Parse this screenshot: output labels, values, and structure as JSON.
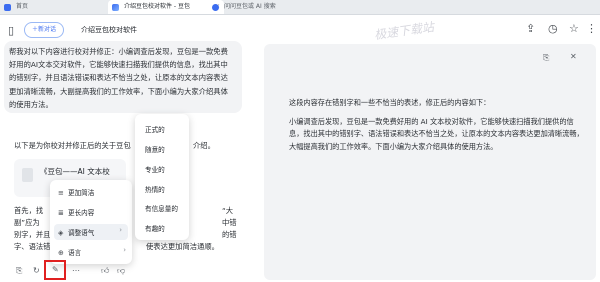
{
  "browser": {
    "tabs": [
      {
        "label": "首页",
        "icon": "home-icon",
        "color": "#3b6cf0"
      },
      {
        "label": "介绍豆包校对软件 - 豆包",
        "icon": "doubao-icon",
        "color": "#3b6cf0"
      },
      {
        "label": "问问豆包或 AI 搜索",
        "icon": "search-icon",
        "color": "#3b6cf0"
      }
    ]
  },
  "header": {
    "new_chat": "新对话",
    "title": "介绍豆包校对软件"
  },
  "watermark": "极速下载站",
  "chat": {
    "user_message": "帮我对以下内容进行校对并修正：小编调查后发现，豆包是一款免费好用的AI文本交对软件，它能够快速扫描我们提供的信息，找出其中的错别字，并且语法错误和表达不恰当之处，让原本的文本内容表达更加清晰流畅，大副提高我们的工作效率，下面小编为大家介绍具体的使用方法。",
    "reply_intro": "以下是为你校对并修正后的关于豆包",
    "reply_intro_tail": "介绍。",
    "doc_title": "《豆包——AI 文本校",
    "para_lines": [
      "首先，找",
      "副”应为",
      "别字，并且",
      "字、语法错"
    ],
    "para_right": [
      "“大",
      "中错",
      "的错",
      "使表达更加简洁通顺。"
    ]
  },
  "menu_primary": [
    {
      "label": "更加简洁",
      "icon": "lines-icon"
    },
    {
      "label": "更长内容",
      "icon": "expand-icon"
    },
    {
      "label": "调整语气",
      "icon": "tone-icon"
    },
    {
      "label": "语言",
      "icon": "language-icon"
    }
  ],
  "menu_tone": [
    "正式的",
    "随意的",
    "专业的",
    "热情的",
    "有信息量的",
    "有趣的"
  ],
  "panel": {
    "heading": "这段内容存在错别字和一些不恰当的表述，修正后的内容如下：",
    "body": "小编调查后发现，豆包是一款免费好用的 AI 文本校对软件，它能够快速扫描我们提供的信息，找出其中的错别字、语法错误和表达不恰当之处，让原本的文本内容表达更加清晰流畅，大幅提高我们的工作效率。下面小编为大家介绍具体的使用方法。"
  }
}
